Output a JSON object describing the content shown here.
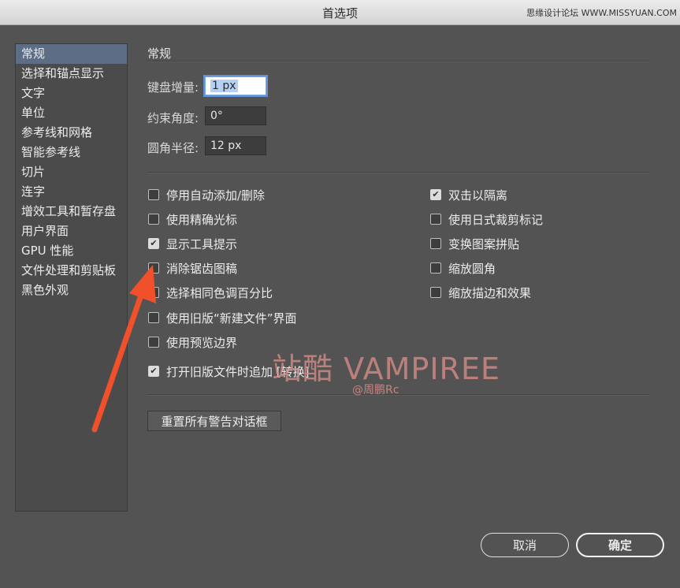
{
  "window": {
    "title": "首选项",
    "site_watermark": "思缘设计论坛 WWW.MISSYUAN.COM"
  },
  "sidebar": {
    "items": [
      {
        "label": "常规",
        "selected": true
      },
      {
        "label": "选择和锚点显示"
      },
      {
        "label": "文字"
      },
      {
        "label": "单位"
      },
      {
        "label": "参考线和网格"
      },
      {
        "label": "智能参考线"
      },
      {
        "label": "切片"
      },
      {
        "label": "连字"
      },
      {
        "label": "增效工具和暂存盘"
      },
      {
        "label": "用户界面"
      },
      {
        "label": "GPU 性能"
      },
      {
        "label": "文件处理和剪贴板"
      },
      {
        "label": "黑色外观"
      }
    ]
  },
  "section_title": "常规",
  "fields": {
    "keyboard_increment": {
      "label": "键盘增量:",
      "value": "1 px"
    },
    "constrain_angle": {
      "label": "约束角度:",
      "value": "0°"
    },
    "corner_radius": {
      "label": "圆角半径:",
      "value": "12 px"
    }
  },
  "options": {
    "left": [
      {
        "label": "停用自动添加/删除",
        "checked": false
      },
      {
        "label": "使用精确光标",
        "checked": false
      },
      {
        "label": "显示工具提示",
        "checked": true
      },
      {
        "label": "消除锯齿图稿",
        "checked": false
      },
      {
        "label": "选择相同色调百分比",
        "checked": false
      },
      {
        "label": "使用旧版“新建文件”界面",
        "checked": false
      },
      {
        "label": "使用预览边界",
        "checked": false
      },
      {
        "label": "打开旧版文件时追加 [转换]",
        "checked": true
      }
    ],
    "right": [
      {
        "label": "双击以隔离",
        "checked": true
      },
      {
        "label": "使用日式裁剪标记",
        "checked": false
      },
      {
        "label": "变换图案拼贴",
        "checked": false
      },
      {
        "label": "缩放圆角",
        "checked": false
      },
      {
        "label": "缩放描边和效果",
        "checked": false
      }
    ]
  },
  "reset_button": "重置所有警告对话框",
  "buttons": {
    "cancel": "取消",
    "ok": "确定"
  },
  "watermark": {
    "main": "站酷 VAMPIREE",
    "author": "@周鹏Rc"
  },
  "colors": {
    "background": "#535353",
    "selection": "#5d6d85",
    "arrow": "#f0502a",
    "watermark": "#d38a86"
  }
}
